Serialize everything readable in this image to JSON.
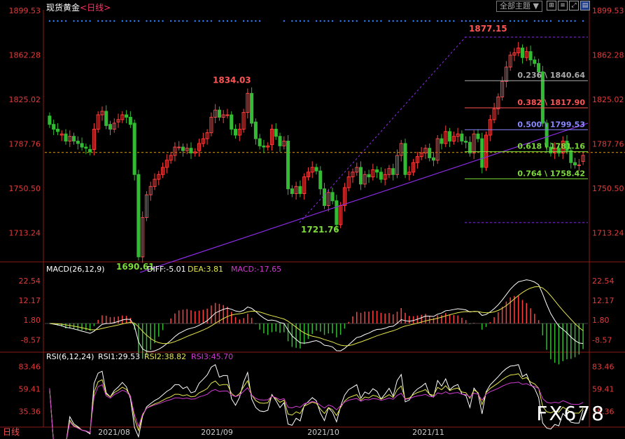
{
  "header": {
    "title": "现货黄金",
    "period_tag": "<日线>",
    "theme_button": "全部主题",
    "theme_arrow": "▼"
  },
  "footer": {
    "period": "日线"
  },
  "watermark": "FX678",
  "colors": {
    "up": "#ff4040",
    "down": "#33bb33",
    "grid_axis_text": "#e23b3b",
    "fib_line": "#ffffff",
    "trend": "#8a2be2"
  },
  "chart_data": [
    {
      "type": "candlestick",
      "panel": "price",
      "yticks": [
        1899.53,
        1862.28,
        1825.02,
        1787.76,
        1750.5,
        1713.24
      ],
      "ylim": [
        1690,
        1900
      ],
      "xticks": [
        "2021/08",
        "2021/09",
        "2021/10",
        "2021/11"
      ],
      "annotations": [
        {
          "label": "1690.61",
          "value": 1690.61
        },
        {
          "label": "1834.03",
          "value": 1834.03
        },
        {
          "label": "1721.76",
          "value": 1721.76
        },
        {
          "label": "1877.15",
          "value": 1877.15
        }
      ],
      "fibonacci": [
        {
          "label": "0.236 \\ 1840.64",
          "value": 1840.64
        },
        {
          "label": "0.382 \\ 1817.90",
          "value": 1817.9
        },
        {
          "label": "0.500 \\ 1799.53",
          "value": 1799.53
        },
        {
          "label": "0.618 \\ 1781.16",
          "value": 1781.16
        },
        {
          "label": "0.764 \\ 1758.42",
          "value": 1758.42
        }
      ],
      "reference_line": 1780.5,
      "close": [
        1804,
        1800,
        1798,
        1796,
        1790,
        1794,
        1790,
        1788,
        1785,
        1784,
        1781,
        1800,
        1812,
        1815,
        1803,
        1800,
        1805,
        1808,
        1812,
        1810,
        1804,
        1762,
        1693,
        1726,
        1745,
        1752,
        1758,
        1762,
        1768,
        1774,
        1778,
        1785,
        1785,
        1782,
        1784,
        1780,
        1781,
        1788,
        1792,
        1797,
        1810,
        1816,
        1810,
        1812,
        1812,
        1800,
        1795,
        1800,
        1814,
        1830,
        1805,
        1792,
        1786,
        1785,
        1786,
        1800,
        1794,
        1786,
        1790,
        1750,
        1746,
        1752,
        1746,
        1760,
        1764,
        1768,
        1765,
        1750,
        1736,
        1747,
        1740,
        1720,
        1736,
        1751,
        1760,
        1764,
        1768,
        1754,
        1762,
        1760,
        1766,
        1764,
        1758,
        1762,
        1767,
        1762,
        1778,
        1788,
        1762,
        1764,
        1772,
        1777,
        1780,
        1784,
        1776,
        1774,
        1792,
        1788,
        1798,
        1790,
        1794,
        1796,
        1790,
        1789,
        1780,
        1796,
        1792,
        1768,
        1795,
        1808,
        1817,
        1827,
        1840,
        1852,
        1862,
        1864,
        1868,
        1860,
        1865,
        1858,
        1855,
        1848,
        1805,
        1785,
        1780,
        1784,
        1780,
        1790,
        1782,
        1772,
        1770,
        1770,
        1778
      ],
      "open": [
        1811,
        1804,
        1800,
        1795,
        1796,
        1790,
        1794,
        1790,
        1788,
        1785,
        1783,
        1783,
        1800,
        1812,
        1815,
        1804,
        1800,
        1806,
        1808,
        1812,
        1810,
        1805,
        1762,
        1693,
        1726,
        1745,
        1752,
        1758,
        1762,
        1768,
        1774,
        1778,
        1785,
        1785,
        1782,
        1784,
        1780,
        1782,
        1788,
        1792,
        1797,
        1810,
        1816,
        1810,
        1812,
        1812,
        1800,
        1795,
        1800,
        1814,
        1830,
        1806,
        1792,
        1786,
        1785,
        1787,
        1800,
        1794,
        1786,
        1790,
        1750,
        1746,
        1752,
        1746,
        1760,
        1764,
        1768,
        1765,
        1750,
        1736,
        1747,
        1740,
        1720,
        1736,
        1751,
        1760,
        1764,
        1768,
        1754,
        1762,
        1760,
        1766,
        1764,
        1758,
        1762,
        1767,
        1762,
        1778,
        1788,
        1762,
        1764,
        1772,
        1777,
        1780,
        1784,
        1776,
        1774,
        1792,
        1788,
        1798,
        1790,
        1794,
        1796,
        1790,
        1789,
        1780,
        1796,
        1792,
        1768,
        1795,
        1808,
        1817,
        1827,
        1840,
        1852,
        1862,
        1864,
        1868,
        1860,
        1865,
        1858,
        1855,
        1848,
        1805,
        1785,
        1780,
        1784,
        1780,
        1790,
        1782,
        1772,
        1770,
        1773
      ],
      "macd": {
        "label": "MACD(26,12,9)",
        "values": [
          "DIFF:-5.01",
          "DEA:3.81",
          "MACD:-17.65"
        ],
        "yticks": [
          22.54,
          12.17,
          1.8,
          -8.57
        ],
        "ylim": [
          -14,
          28
        ]
      },
      "rsi": {
        "label": "RSI(6,12,24)",
        "values": [
          "RSI1:29.53",
          "RSI2:38.82",
          "RSI3:45.70"
        ],
        "yticks": [
          83.46,
          59.41,
          35.36
        ],
        "ylim": [
          20,
          90
        ]
      }
    }
  ]
}
